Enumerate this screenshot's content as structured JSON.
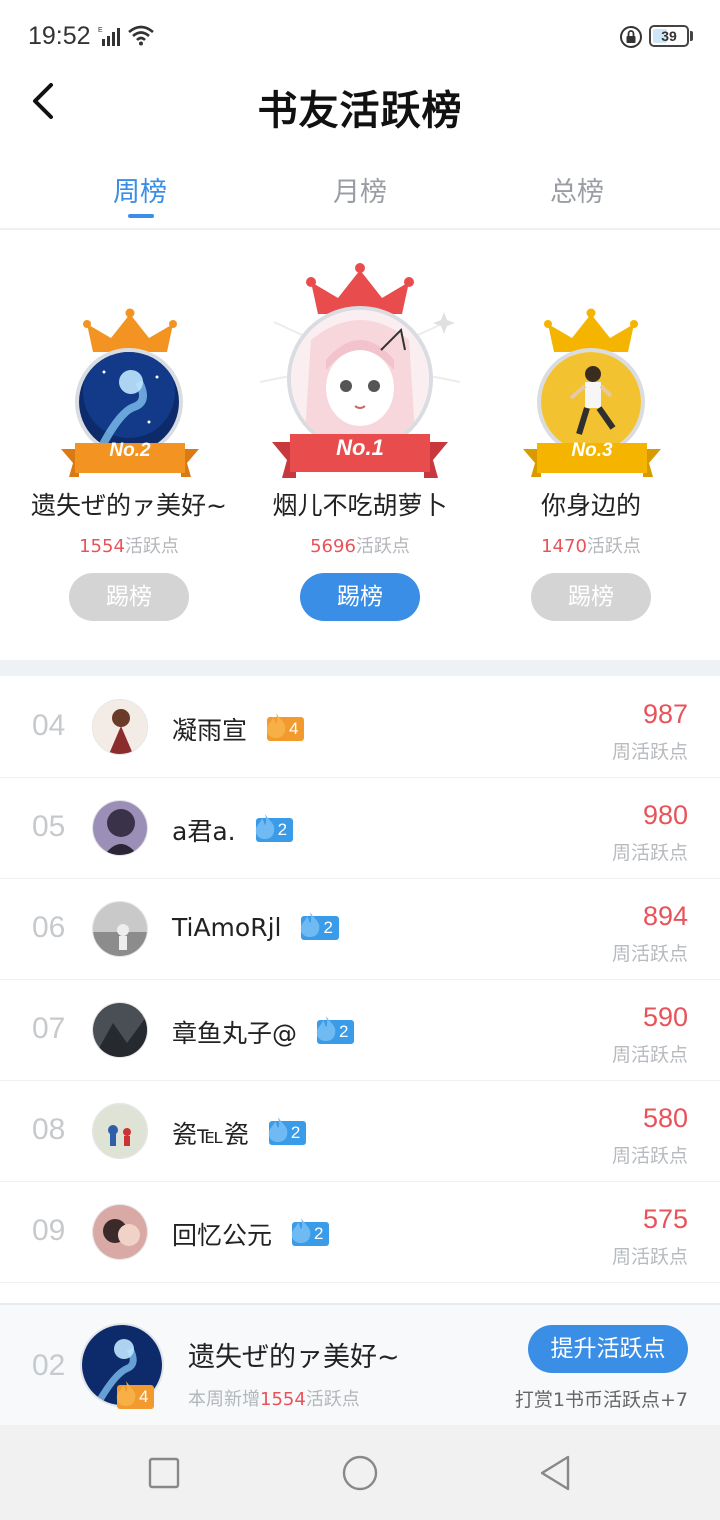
{
  "status_bar": {
    "time": "19:52",
    "battery": "39",
    "icons": [
      "signal-icon",
      "wifi-icon",
      "screen-lock-icon",
      "battery-icon"
    ]
  },
  "header": {
    "title": "书友活跃榜",
    "back_icon": "chevron-left-icon"
  },
  "tabs": [
    {
      "label": "周榜",
      "active": true
    },
    {
      "label": "月榜",
      "active": false
    },
    {
      "label": "总榜",
      "active": false
    }
  ],
  "podium": {
    "first": {
      "rank_label": "No.1",
      "name": "烟儿不吃胡萝卜",
      "points": "5696",
      "points_suffix": "活跃点",
      "button": "踢榜",
      "color": "#e84c4c"
    },
    "second": {
      "rank_label": "No.2",
      "name": "遗失ぜ的ァ美好~",
      "points": "1554",
      "points_suffix": "活跃点",
      "button": "踢榜",
      "color": "#f39422"
    },
    "third": {
      "rank_label": "No.3",
      "name": "你身边的",
      "points": "1470",
      "points_suffix": "活跃点",
      "button": "踢榜",
      "color": "#f5b400"
    }
  },
  "list": [
    {
      "rank": "04",
      "name": "凝雨宣",
      "level": "4",
      "badge_color": "orange",
      "score": "987",
      "score_label": "周活跃点"
    },
    {
      "rank": "05",
      "name": "a君a.",
      "level": "2",
      "badge_color": "blue",
      "score": "980",
      "score_label": "周活跃点"
    },
    {
      "rank": "06",
      "name": "TiAmoRjl",
      "level": "2",
      "badge_color": "blue",
      "score": "894",
      "score_label": "周活跃点"
    },
    {
      "rank": "07",
      "name": "章鱼丸子@",
      "level": "2",
      "badge_color": "blue",
      "score": "590",
      "score_label": "周活跃点"
    },
    {
      "rank": "08",
      "name": "瓷℡瓷",
      "level": "2",
      "badge_color": "blue",
      "score": "580",
      "score_label": "周活跃点"
    },
    {
      "rank": "09",
      "name": "回忆公元",
      "level": "2",
      "badge_color": "blue",
      "score": "575",
      "score_label": "周活跃点"
    }
  ],
  "my_rank": {
    "rank": "02",
    "name": "遗失ぜ的ァ美好~",
    "level": "4",
    "sub_prefix": "本周新增",
    "sub_points": "1554",
    "sub_suffix": "活跃点",
    "button": "提升活跃点",
    "hint": "打赏1书币活跃点+7"
  },
  "colors": {
    "accent": "#3a8ee6",
    "score_red": "#e8535a",
    "gold": "#f5b400",
    "orange": "#f39422"
  }
}
